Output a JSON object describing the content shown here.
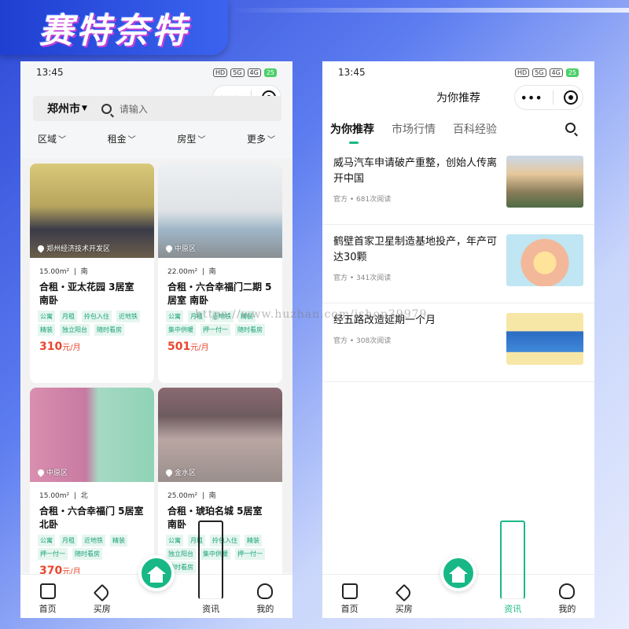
{
  "banner": {
    "title": "赛特奈特"
  },
  "watermark": "https://www.huzhan.com/ishop39979",
  "left_screen": {
    "status": {
      "time": "13:45",
      "icons": [
        "HD",
        "5G",
        "4G",
        "wifi",
        "25"
      ]
    },
    "city": "郑州市",
    "search_placeholder": "请输入",
    "filters": [
      "区域",
      "租金",
      "房型",
      "更多"
    ],
    "listings": [
      {
        "location": "郑州经济技术开发区",
        "area": "15.00m²",
        "orientation": "南",
        "title": "合租・亚太花园 3居室 南卧",
        "tags": [
          "公寓",
          "月租",
          "拎包入住",
          "近地铁",
          "精装",
          "独立阳台",
          "随时看房"
        ],
        "price": "310",
        "unit": "元/月"
      },
      {
        "location": "中原区",
        "area": "22.00m²",
        "orientation": "南",
        "title": "合租・六合幸福门二期 5居室 南卧",
        "tags": [
          "公寓",
          "月租",
          "近地铁",
          "精装",
          "集中供暖",
          "押一付一",
          "随时看房"
        ],
        "price": "501",
        "unit": "元/月"
      },
      {
        "location": "中原区",
        "area": "15.00m²",
        "orientation": "北",
        "title": "合租・六合幸福门 5居室 北卧",
        "tags": [
          "公寓",
          "月租",
          "近地铁",
          "精装",
          "押一付一",
          "随时看房"
        ],
        "price": "370",
        "unit": "元/月"
      },
      {
        "location": "金水区",
        "area": "25.00m²",
        "orientation": "南",
        "title": "合租・琥珀名城 5居室 南卧",
        "tags": [
          "公寓",
          "月租",
          "拎包入住",
          "精装",
          "独立阳台",
          "集中供暖",
          "押一付一",
          "随时看房"
        ],
        "price": "",
        "unit": ""
      }
    ],
    "tabbar": [
      "首页",
      "买房",
      "",
      "资讯",
      "我的"
    ]
  },
  "right_screen": {
    "status": {
      "time": "13:45",
      "icons": [
        "HD",
        "5G",
        "4G",
        "wifi",
        "25"
      ]
    },
    "page_title": "为你推荐",
    "tabs": [
      "为你推荐",
      "市场行情",
      "百科经验"
    ],
    "news": [
      {
        "title": "威马汽车申请破产重整，创始人传离开中国",
        "meta": "官方 • 681次阅读"
      },
      {
        "title": "鹤壁首家卫星制造基地投产，年产可达30颗",
        "meta": "官方 • 341次阅读"
      },
      {
        "title": "经五路改造延期一个月",
        "meta": "官方 • 308次阅读"
      }
    ],
    "tabbar": [
      "首页",
      "买房",
      "",
      "资讯",
      "我的"
    ]
  },
  "colors": {
    "accent": "#17b886",
    "price": "#e8472e",
    "banner": "#1f3fd0"
  }
}
